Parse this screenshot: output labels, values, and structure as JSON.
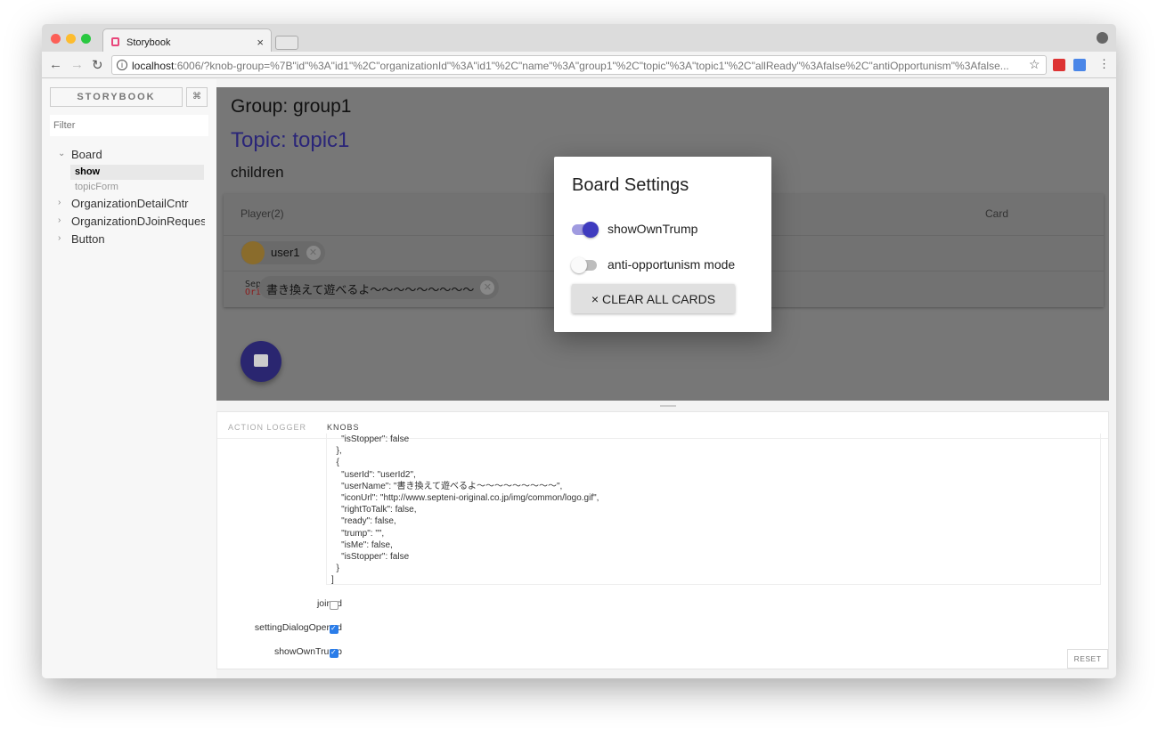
{
  "browser": {
    "tab_title": "Storybook",
    "url_host": "localhost",
    "url_rest": ":6006/?knob-group=%7B\"id\"%3A\"id1\"%2C\"organizationId\"%3A\"id1\"%2C\"name\"%3A\"group1\"%2C\"topic\"%3A\"topic1\"%2C\"allReady\"%3Afalse%2C\"antiOpportunism\"%3Afalse..."
  },
  "sidebar": {
    "brand": "STORYBOOK",
    "shortcut": "⌘",
    "filter_placeholder": "Filter",
    "tree": [
      {
        "label": "Board",
        "expanded": true,
        "children": [
          {
            "label": "show",
            "active": true
          },
          {
            "label": "topicForm"
          }
        ]
      },
      {
        "label": "OrganizationDetailCntr"
      },
      {
        "label": "OrganizationDJoinRequest"
      },
      {
        "label": "Button"
      }
    ]
  },
  "preview": {
    "group": "Group: group1",
    "topic": "Topic: topic1",
    "children": "children",
    "table": {
      "headers": [
        "Player(2)",
        "Card"
      ],
      "players": [
        "user1",
        "書き換えて遊べるよ〜〜〜〜〜〜〜〜〜"
      ],
      "logo_text": [
        "Sep",
        "Ori"
      ]
    }
  },
  "dialog": {
    "title": "Board Settings",
    "toggles": [
      {
        "label": "showOwnTrump",
        "on": true
      },
      {
        "label": "anti-opportunism mode",
        "on": false
      }
    ],
    "clear_button": "CLEAR ALL CARDS",
    "clear_icon": "×"
  },
  "addons": {
    "tabs": [
      "ACTION LOGGER",
      "KNOBS"
    ],
    "active_tab": "KNOBS",
    "json_lines": [
      "    \"isStopper\": false",
      "  },",
      "  {",
      "    \"userId\": \"userId2\",",
      "    \"userName\": \"書き換えて遊べるよ〜〜〜〜〜〜〜〜〜\",",
      "    \"iconUrl\": \"http://www.septeni-original.co.jp/img/common/logo.gif\",",
      "    \"rightToTalk\": false,",
      "    \"ready\": false,",
      "    \"trump\": \"\",",
      "    \"isMe\": false,",
      "    \"isStopper\": false",
      "  }",
      "]"
    ],
    "knobs": [
      {
        "label": "joined",
        "checked": false
      },
      {
        "label": "settingDialogOpened",
        "checked": true
      },
      {
        "label": "showOwnTrump",
        "checked": true
      }
    ],
    "reset": "RESET"
  }
}
